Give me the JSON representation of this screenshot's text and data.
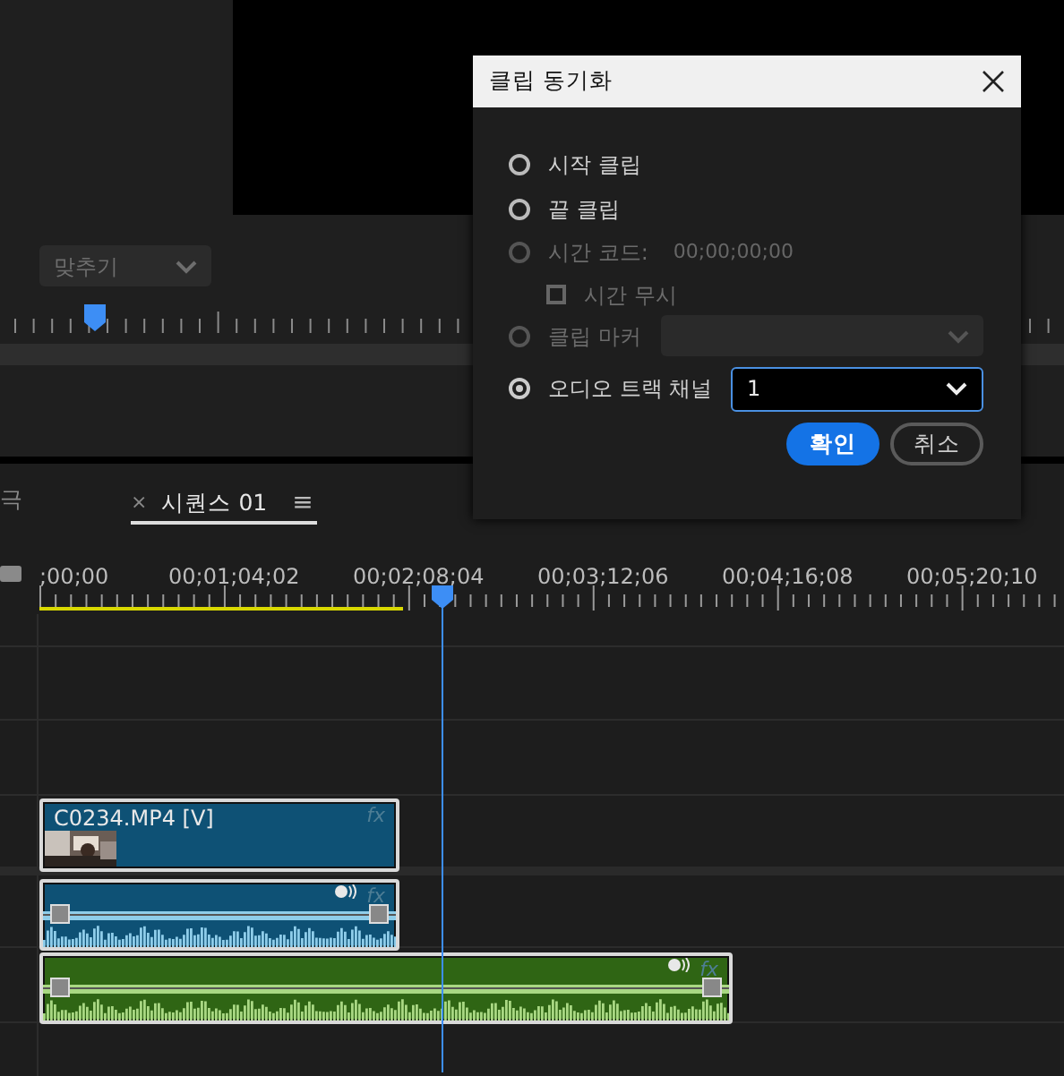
{
  "monitor": {
    "fit_dropdown": {
      "value": "맞추기"
    }
  },
  "timeline": {
    "tabs": [
      {
        "label": "극",
        "selected": false
      },
      {
        "label": "시퀀스 01",
        "selected": true,
        "close": "×",
        "menu": "≡"
      }
    ],
    "timecodes": [
      ";00;00",
      "00;01;04;02",
      "00;02;08;04",
      "00;03;12;06",
      "00;04;16;08",
      "00;05;20;10"
    ],
    "clips": [
      {
        "kind": "video",
        "name": "C0234.MP4 [V]",
        "fx": "fx",
        "color": "#0e5175"
      },
      {
        "kind": "audio",
        "fx": "fx",
        "color": "#0e5175"
      },
      {
        "kind": "audio",
        "fx": "fx",
        "color": "#2f6514"
      }
    ]
  },
  "dialog": {
    "title": "클립 동기화",
    "options": [
      {
        "kind": "radio",
        "label": "시작 클립",
        "selected": false,
        "disabled": false
      },
      {
        "kind": "radio",
        "label": "끝 클립",
        "selected": false,
        "disabled": false
      },
      {
        "kind": "radio",
        "label": "시간 코드:",
        "value": "00;00;00;00",
        "selected": false,
        "disabled": true
      },
      {
        "kind": "checkbox",
        "label": "시간 무시",
        "checked": false,
        "disabled": true
      },
      {
        "kind": "radio",
        "label": "클립 마커",
        "selected": false,
        "disabled": true,
        "dropdown": {
          "disabled": true,
          "focused": false
        }
      },
      {
        "kind": "radio",
        "label": "오디오 트랙 채널",
        "selected": true,
        "disabled": false,
        "dropdown": {
          "value": "1",
          "disabled": false,
          "focused": true
        }
      }
    ],
    "buttons": [
      {
        "label": "확인",
        "primary": true
      },
      {
        "label": "취소",
        "primary": false
      }
    ]
  }
}
